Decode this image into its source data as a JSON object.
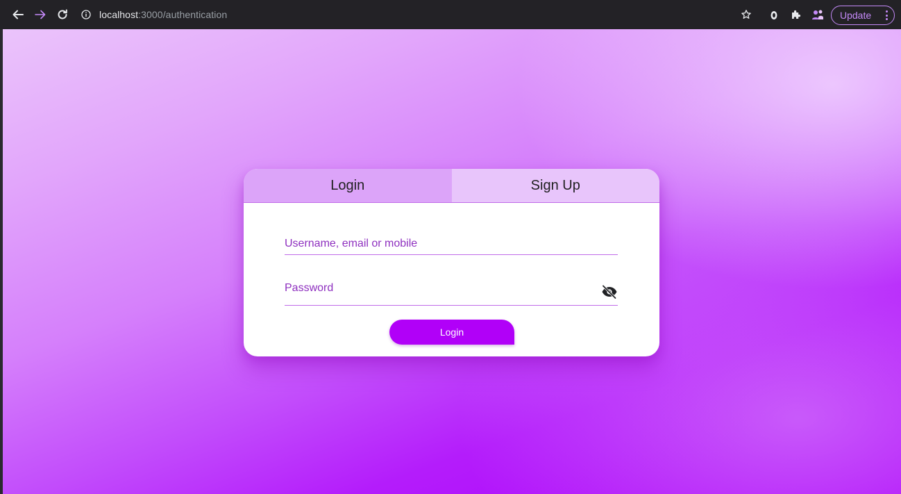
{
  "browser": {
    "url_host": "localhost",
    "url_path": ":3000/authentication",
    "update_label": "Update",
    "icons": {
      "back": "back-arrow-icon",
      "forward": "forward-arrow-icon",
      "reload": "reload-icon",
      "info": "site-info-icon",
      "bookmark": "star-icon",
      "extension1": "extension-icon",
      "puzzle": "puzzle-icon",
      "profile": "profile-icon",
      "menu": "kebab-menu-icon"
    }
  },
  "auth_card": {
    "tabs": [
      {
        "label": "Login",
        "active": true
      },
      {
        "label": "Sign Up",
        "active": false
      }
    ],
    "username_label": "Username, email or mobile",
    "password_label": "Password",
    "password_visibility_icon": "eye-off-icon",
    "submit_label": "Login"
  },
  "colors": {
    "accent": "#b100f8",
    "label": "#8e2fbf",
    "tab_active": "#dca4f9",
    "tab_inactive": "#e8c5fb"
  }
}
